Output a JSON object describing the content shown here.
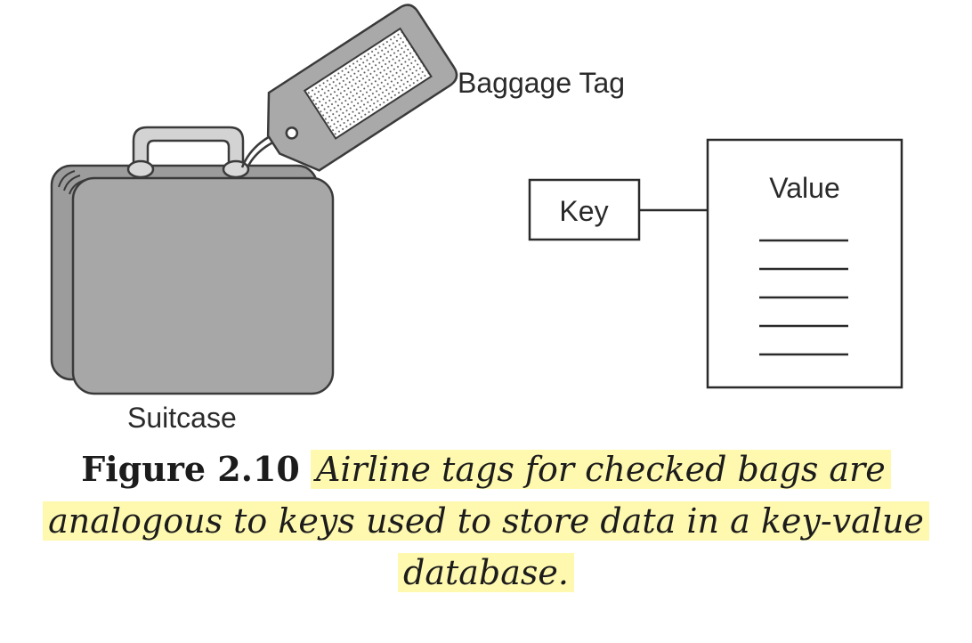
{
  "diagram": {
    "suitcase_label": "Suitcase",
    "baggage_tag_label": "Baggage Tag",
    "key_label": "Key",
    "value_label": "Value",
    "value_line_count": 5
  },
  "caption": {
    "figure_number": "Figure 2.10",
    "line1": "Airline tags for checked bags are",
    "line2": "analogous to keys used to store data in a key-value",
    "line3": "database.",
    "highlight_color": "#fff9b0"
  }
}
